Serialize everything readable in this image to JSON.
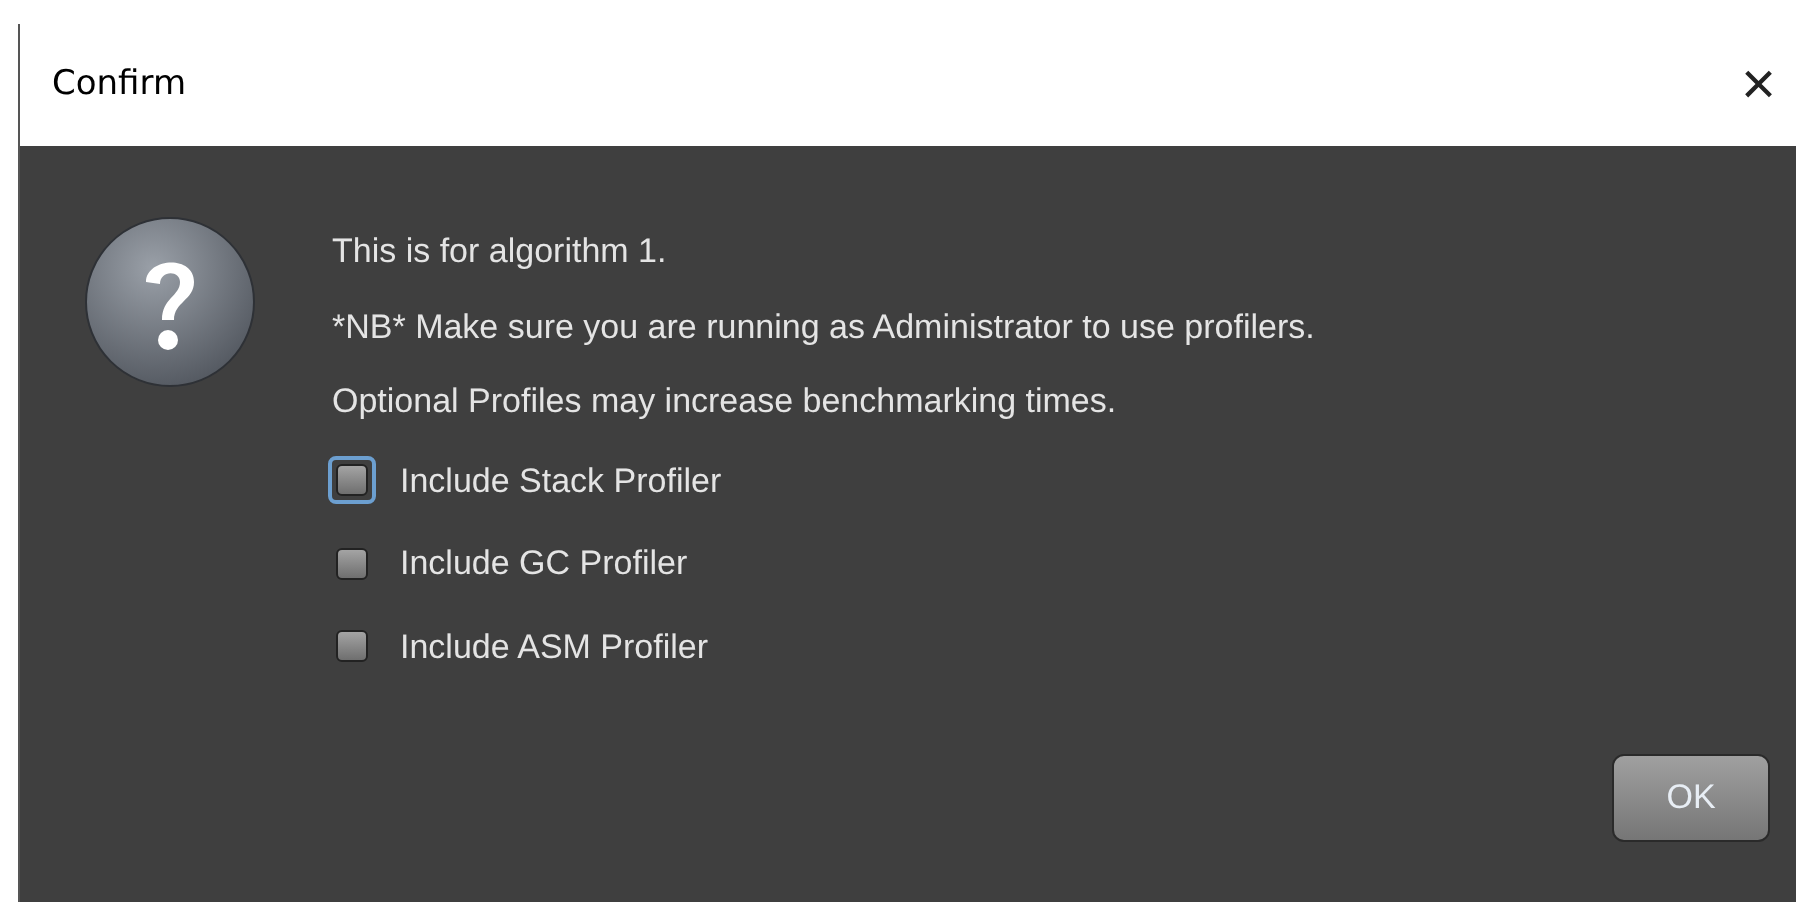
{
  "window": {
    "title": "Confirm",
    "close": "×"
  },
  "message": [
    "This is for algorithm 1.",
    "*NB* Make sure you are running as Administrator to use profilers.",
    "Optional Profiles may increase benchmarking times."
  ],
  "checkboxes": [
    {
      "label": "Include Stack Profiler",
      "checked": false,
      "focused": true
    },
    {
      "label": "Include GC Profiler",
      "checked": false,
      "focused": false
    },
    {
      "label": "Include ASM Profiler",
      "checked": false,
      "focused": false
    }
  ],
  "buttons": [
    "OK"
  ]
}
